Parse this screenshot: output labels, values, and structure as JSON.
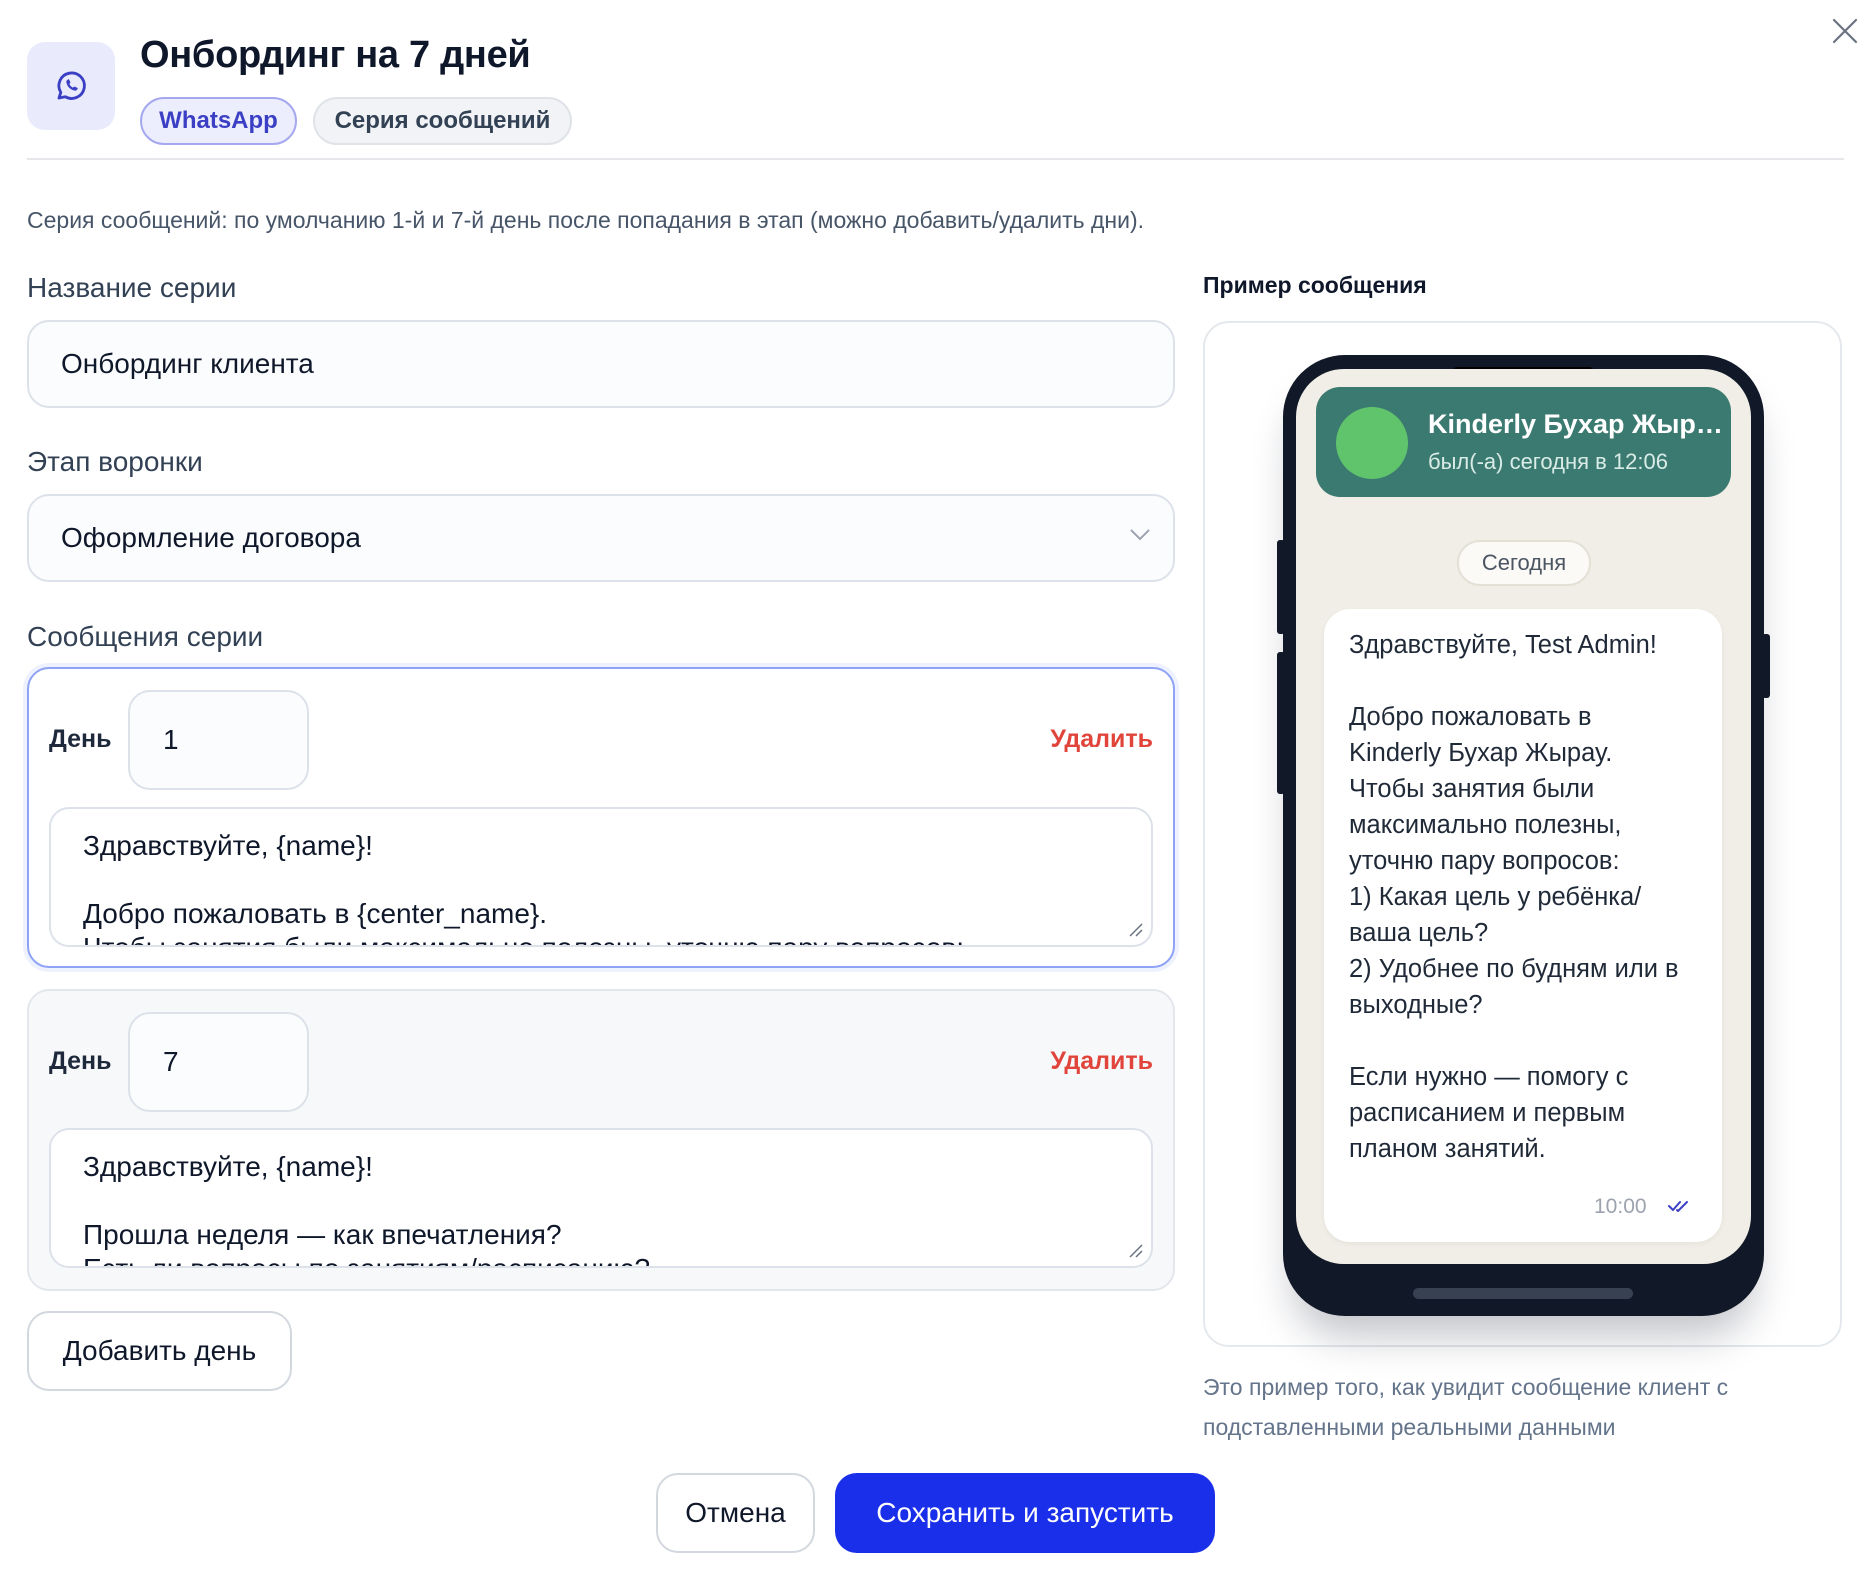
{
  "header": {
    "title": "Онбординг на 7 дней",
    "chips": [
      "WhatsApp",
      "Серия сообщений"
    ],
    "icon": "whatsapp-icon",
    "accent_color": "#3b3fc4"
  },
  "description": "Серия сообщений: по умолчанию 1-й и 7-й день после попадания в этап (можно добавить/удалить дни).",
  "form": {
    "series_name_label": "Название серии",
    "series_name_value": "Онбординг клиента",
    "funnel_stage_label": "Этап воронки",
    "funnel_stage_value": "Оформление договора",
    "messages_label": "Сообщения серии"
  },
  "days": [
    {
      "day_label": "День",
      "day_value": "1",
      "delete_label": "Удалить",
      "text_lines": [
        "Здравствуйте, {name}!",
        "",
        "Добро пожаловать в {center_name}.",
        "Чтобы занятия были максимально полезны, уточню пару вопросов:"
      ]
    },
    {
      "day_label": "День",
      "day_value": "7",
      "delete_label": "Удалить",
      "text_lines": [
        "Здравствуйте, {name}!",
        "",
        "Прошла неделя — как впечатления?",
        "Есть ли вопросы по занятиям/расписанию?"
      ]
    }
  ],
  "add_day_label": "Добавить день",
  "preview": {
    "title": "Пример сообщения",
    "contact_name": "Kinderly Бухар Жырау",
    "contact_status": "был(-а) сегодня в 12:06",
    "date_pill": "Сегодня",
    "message_lines": [
      "Здравствуйте, Test Admin!",
      "",
      "Добро пожаловать в",
      "Kinderly Бухар Жырау.",
      "Чтобы занятия были",
      "максимально полезны,",
      "уточню пару вопросов:",
      "1) Какая цель у ребёнка/",
      "ваша цель?",
      "2) Удобнее по будням или в",
      "выходные?",
      "",
      "Если нужно — помогу с",
      "расписанием и первым",
      "планом занятий."
    ],
    "message_time": "10:00",
    "note_lines": [
      "Это пример того, как увидит сообщение клиент с",
      "подставленными реальными данными"
    ],
    "chat_header_color": "#3b7a70"
  },
  "footer": {
    "cancel_label": "Отмена",
    "save_label": "Сохранить и запустить",
    "save_color": "#1a2fea"
  }
}
